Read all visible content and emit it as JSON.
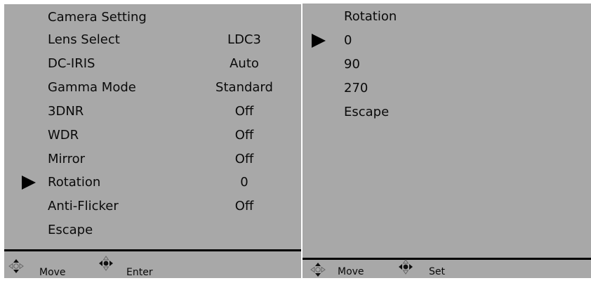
{
  "left": {
    "title": "Camera Setting",
    "items": [
      {
        "label": "Lens Select",
        "value": "LDC3"
      },
      {
        "label": "DC-IRIS",
        "value": "Auto"
      },
      {
        "label": "Gamma Mode",
        "value": "Standard"
      },
      {
        "label": "3DNR",
        "value": "Off"
      },
      {
        "label": "WDR",
        "value": "Off"
      },
      {
        "label": "Mirror",
        "value": "Off"
      },
      {
        "label": "Rotation",
        "value": "0"
      },
      {
        "label": "Anti-Flicker",
        "value": "Off"
      },
      {
        "label": "Escape",
        "value": ""
      }
    ],
    "selected_index": 6,
    "footer": {
      "move_label": "Move",
      "enter_label": "Enter"
    }
  },
  "right": {
    "title": "Rotation",
    "options": [
      "0",
      "90",
      "270",
      "Escape"
    ],
    "selected_index": 0,
    "footer": {
      "move_label": "Move",
      "set_label": "Set"
    }
  },
  "colors": {
    "panel_bg": "#a8a8a8",
    "text": "#0a0a0a",
    "cursor": "#000000"
  },
  "icons": [
    "cursor-arrow-icon",
    "dpad-updown-icon",
    "dpad-leftright-icon"
  ]
}
